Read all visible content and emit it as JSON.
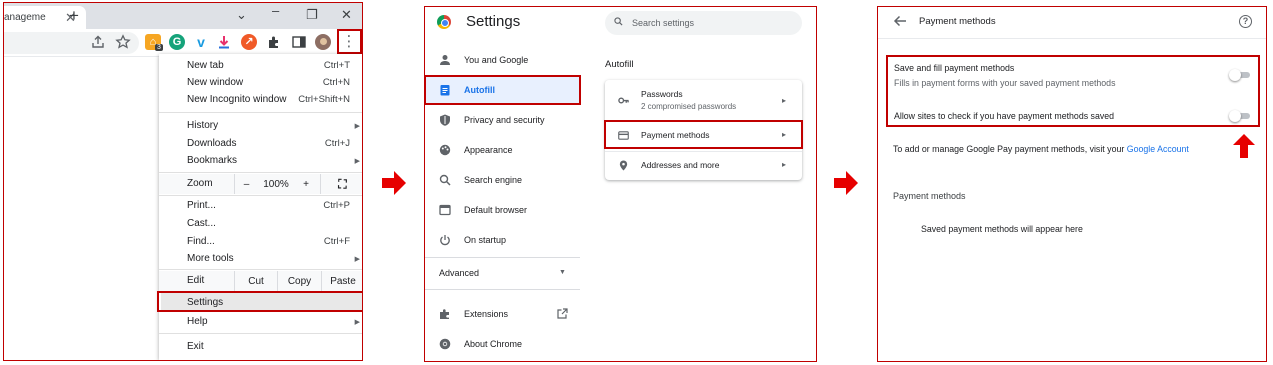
{
  "colors": {
    "highlight": "#c00000",
    "flow_arrow": "#e60000",
    "accent": "#1a73e8"
  },
  "browser": {
    "tab_title": "anageme",
    "menu": {
      "new_tab": "New tab",
      "new_tab_key": "Ctrl+T",
      "new_window": "New window",
      "new_window_key": "Ctrl+N",
      "incognito": "New Incognito window",
      "incognito_key": "Ctrl+Shift+N",
      "history": "History",
      "downloads": "Downloads",
      "downloads_key": "Ctrl+J",
      "bookmarks": "Bookmarks",
      "zoom": "Zoom",
      "zoom_minus": "–",
      "zoom_level": "100%",
      "zoom_plus": "+",
      "print": "Print...",
      "print_key": "Ctrl+P",
      "cast": "Cast...",
      "find": "Find...",
      "find_key": "Ctrl+F",
      "more_tools": "More tools",
      "edit": "Edit",
      "cut": "Cut",
      "copy": "Copy",
      "paste": "Paste",
      "settings": "Settings",
      "help": "Help",
      "exit": "Exit"
    },
    "extension_badge": "3"
  },
  "settings": {
    "title": "Settings",
    "search_placeholder": "Search settings",
    "nav": {
      "you_and_google": "You and Google",
      "autofill": "Autofill",
      "privacy": "Privacy and security",
      "appearance": "Appearance",
      "search_engine": "Search engine",
      "default_browser": "Default browser",
      "on_startup": "On startup",
      "advanced": "Advanced",
      "extensions": "Extensions",
      "about": "About Chrome"
    },
    "section": "Autofill",
    "rows": {
      "passwords": "Passwords",
      "passwords_sub": "2 compromised passwords",
      "payment_methods": "Payment methods",
      "addresses": "Addresses and more"
    }
  },
  "payment": {
    "title": "Payment methods",
    "save_fill_label": "Save and fill payment methods",
    "save_fill_sub": "Fills in payment forms with your saved payment methods",
    "save_fill_enabled": false,
    "allow_check_label": "Allow sites to check if you have payment methods saved",
    "allow_check_enabled": false,
    "gpay_text": "To add or manage Google Pay payment methods, visit your",
    "gpay_link": "Google Account",
    "section_title": "Payment methods",
    "empty_text": "Saved payment methods will appear here"
  }
}
